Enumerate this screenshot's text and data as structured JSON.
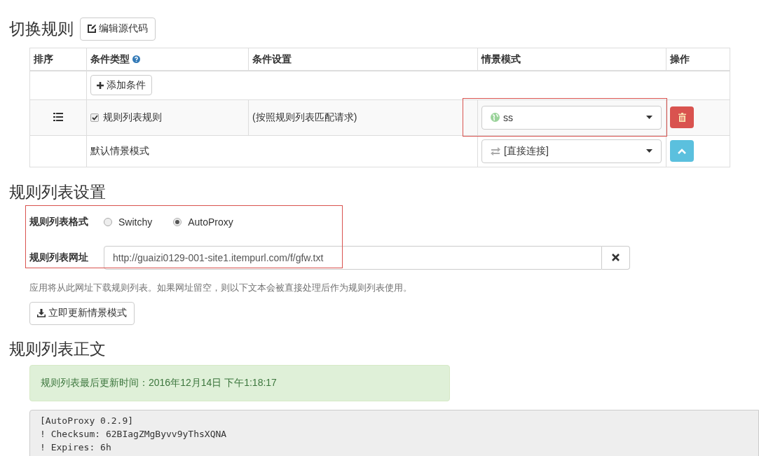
{
  "switch_rules": {
    "title": "切换规则",
    "edit_button": "编辑源代码",
    "columns": [
      {
        "label": "排序",
        "help": false
      },
      {
        "label": "条件类型",
        "help": true
      },
      {
        "label": "条件设置",
        "help": false
      },
      {
        "label": "情景模式",
        "help": false
      },
      {
        "label": "操作",
        "help": false
      }
    ],
    "add_button": "添加条件",
    "rows": [
      {
        "kind": "rule",
        "checked": true,
        "type": "规则列表规则",
        "setting": "(按照规则列表匹配请求)",
        "profile": "ss",
        "highlighted": true
      },
      {
        "kind": "default",
        "type": "默认情景模式",
        "profile": "[直接连接]",
        "highlighted": false
      }
    ]
  },
  "rule_list_settings": {
    "title": "规则列表设置",
    "highlighted": true,
    "format": {
      "label": "规则列表格式",
      "options": [
        {
          "label": "Switchy",
          "selected": false
        },
        {
          "label": "AutoProxy",
          "selected": true
        }
      ]
    },
    "url": {
      "label": "规则列表网址",
      "value": "http://guaizi0129-001-site1.itempurl.com/f/gfw.txt"
    },
    "help": "应用将从此网址下载规则列表。如果网址留空，则以下文本会被直接处理后作为规则列表使用。",
    "update_button": "立即更新情景模式"
  },
  "rule_list_text": {
    "title": "规则列表正文",
    "alert": "规则列表最后更新时间：2016年12月14日 下午1:18:17",
    "lines": [
      "[AutoProxy 0.2.9]",
      "! Checksum: 62BIagZMgByvv9yThsXQNA",
      "! Expires: 6h"
    ]
  }
}
